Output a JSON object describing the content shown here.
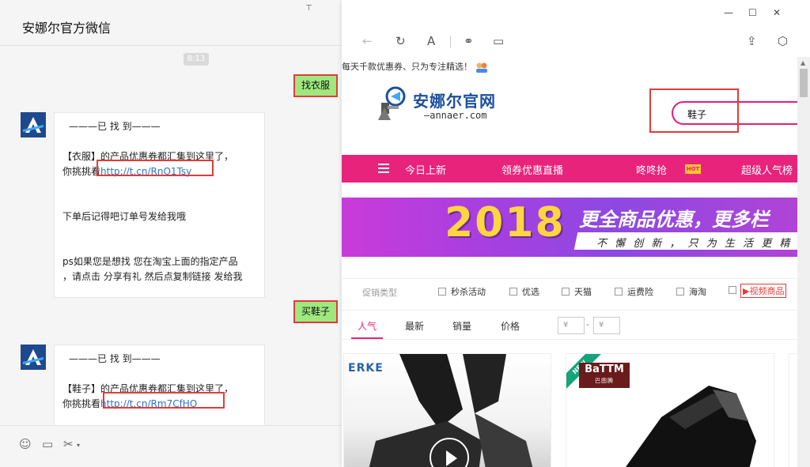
{
  "chat": {
    "title": "安娜尔官方微信",
    "time": "8:13",
    "sent_1": "找衣服",
    "reply_1": {
      "header": "———已 找 到———",
      "line1": "【衣服】的产品优惠券都汇集到这里了，",
      "line2_prefix": "你挑挑看",
      "link": "http://t.cn/RnO1Tsy",
      "line3": "下单后记得吧订单号发给我哦",
      "line4": "ps如果您是想找 您在淘宝上面的指定产品",
      "line5": "，请点击 分享有礼 然后点复制链接 发给我"
    },
    "sent_2": "买鞋子",
    "reply_2": {
      "header": "———已 找 到———",
      "line1": "【鞋子】的产品优惠券都汇集到这里了，",
      "line2_prefix": "你挑挑看",
      "link": "http://t.cn/Rm7CfHO"
    }
  },
  "browser": {
    "topbar_text": "每天千款优惠券、只为专注精选！",
    "logo_text": "安娜尔官网",
    "logo_sub": "—annaer.com",
    "search_value": "鞋子",
    "nav": [
      "今日上新",
      "领券优惠直播",
      "咚咚抢",
      "超级人气榜"
    ],
    "hot_badge": "HOT",
    "banner": {
      "year": "2018",
      "slogan": "更全商品优惠，更多栏",
      "sub": "不 懈 创 新 ， 只 为 生 活 更 精"
    },
    "filter_label": "促销类型",
    "filters": [
      "秒杀活动",
      "优选",
      "天猫",
      "运费险",
      "海淘"
    ],
    "video_filter": "▶视频商品",
    "sort_tabs": [
      "人气",
      "最新",
      "销量",
      "价格"
    ],
    "price_min_placeholder": "¥",
    "price_max_placeholder": "¥",
    "price_dash": "-",
    "products": [
      {
        "brand": "ERKE"
      },
      {
        "ribbon": "NEW",
        "brand": "BaTTM",
        "brand_sub": "巴图腾"
      }
    ]
  },
  "colors": {
    "accent_pink": "#e8237c",
    "chat_bubble_green": "#9fe87f",
    "highlight_red": "#e23b3b",
    "link_blue": "#2d75c6"
  }
}
